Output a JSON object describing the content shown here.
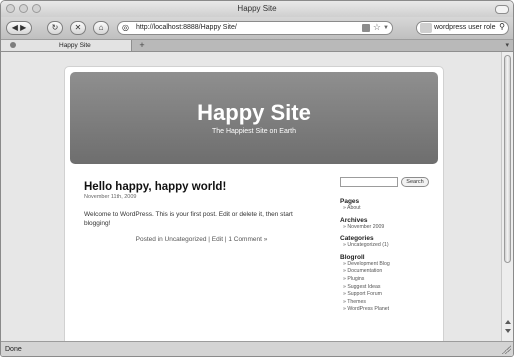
{
  "window": {
    "title": "Happy Site"
  },
  "toolbar": {
    "url": "http://localhost:8888/Happy Site/",
    "search_value": "wordpress user role"
  },
  "tabs": [
    {
      "label": "Happy Site"
    }
  ],
  "status": "Done",
  "site": {
    "title": "Happy Site",
    "tagline": "The Happiest Site on Earth"
  },
  "post": {
    "title": "Hello happy, happy world!",
    "date": "November 11th, 2009",
    "body": "Welcome to WordPress. This is your first post. Edit or delete it, then start blogging!",
    "meta_prefix": "Posted in",
    "category": "Uncategorized",
    "edit": "Edit",
    "comments": "1 Comment »"
  },
  "sidebar": {
    "search_button": "Search",
    "pages_title": "Pages",
    "pages": [
      "About"
    ],
    "archives_title": "Archives",
    "archives": [
      "November 2009"
    ],
    "categories_title": "Categories",
    "categories": [
      "Uncategorized (1)"
    ],
    "blogroll_title": "Blogroll",
    "blogroll": [
      "Development Blog",
      "Documentation",
      "Plugins",
      "Suggest Ideas",
      "Support Forum",
      "Themes",
      "WordPress Planet"
    ]
  }
}
